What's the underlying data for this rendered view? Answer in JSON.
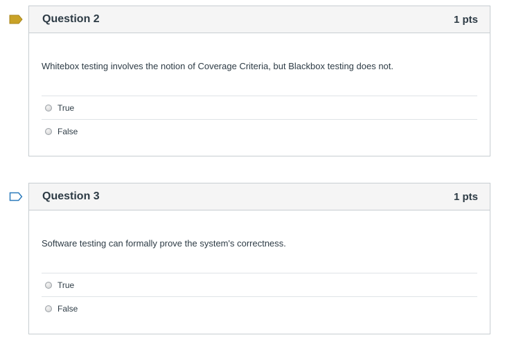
{
  "questions": [
    {
      "title": "Question 2",
      "points": "1 pts",
      "text": "Whitebox testing involves the notion of Coverage Criteria, but Blackbox testing does not.",
      "flagged": true,
      "answers": [
        "True",
        "False"
      ]
    },
    {
      "title": "Question 3",
      "points": "1 pts",
      "text": "Software testing can formally prove the system's correctness.",
      "flagged": false,
      "answers": [
        "True",
        "False"
      ]
    }
  ],
  "colors": {
    "flag_filled": "#c9a227",
    "flag_outline": "#2b7abc",
    "border": "#c7cdd1",
    "header_bg": "#f5f5f5",
    "text": "#2d3b45"
  }
}
